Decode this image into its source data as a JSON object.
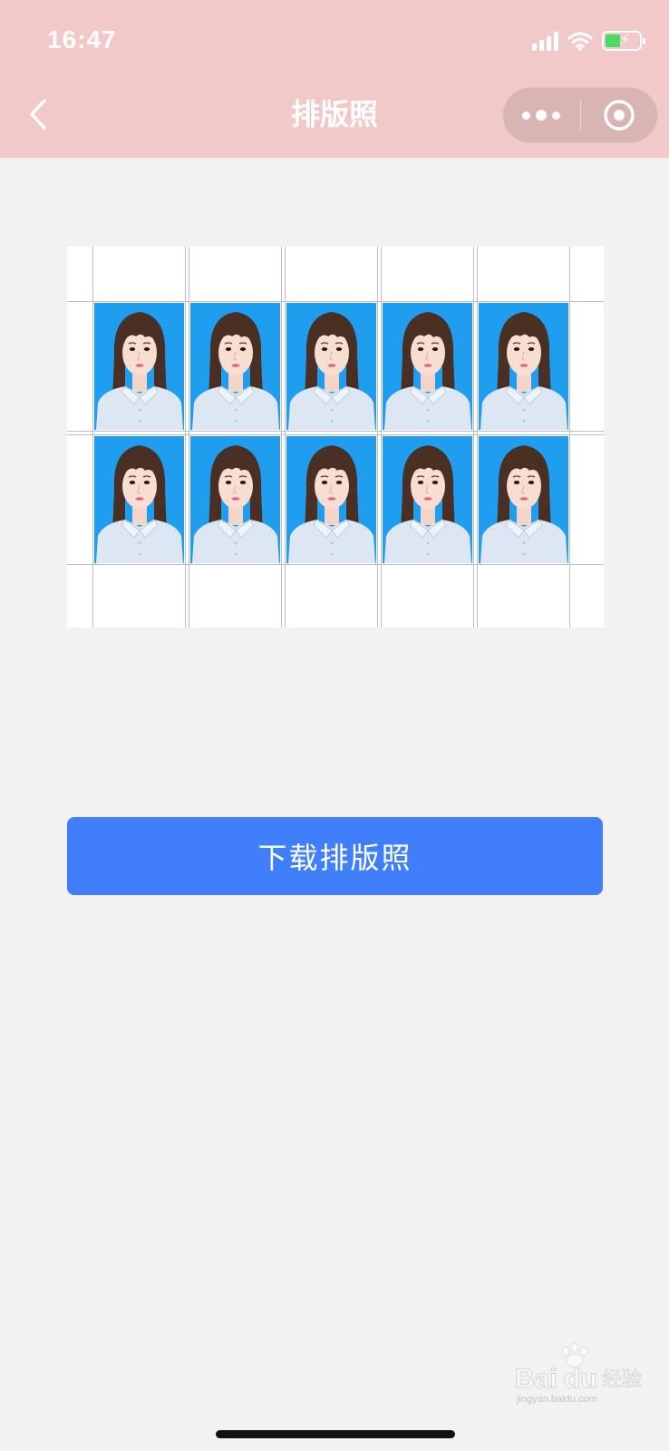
{
  "status_bar": {
    "time": "16:47",
    "icons": [
      "cellular-signal-icon",
      "wifi-icon",
      "battery-charging-icon"
    ]
  },
  "nav": {
    "title": "排版照",
    "back_icon": "chevron-left-icon",
    "more_icon": "more-dots-icon",
    "close_icon": "target-circle-icon"
  },
  "layout_sheet": {
    "columns": 5,
    "rows": 2,
    "photo_background": "#1f9ef0"
  },
  "actions": {
    "download_label": "下载排版照"
  },
  "watermark": {
    "text": "Baidu经验",
    "subtext": "jingyan.baidu.com"
  },
  "colors": {
    "header": "#f1c9c8",
    "page_bg": "#f2f2f2",
    "primary_button": "#407ff9"
  }
}
